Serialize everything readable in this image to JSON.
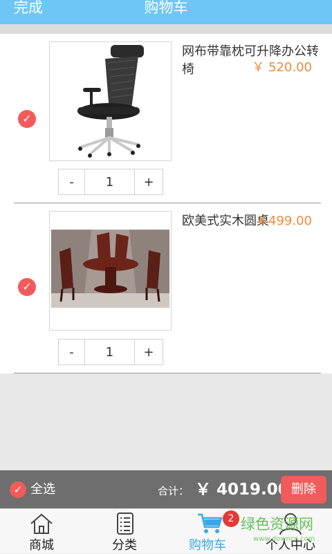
{
  "header": {
    "done_label": "完成",
    "title": "购物车"
  },
  "cart": {
    "items": [
      {
        "name": "网布带靠枕可升降办公转椅",
        "price": "￥ 520.00",
        "quantity": "1",
        "minus": "-",
        "plus": "+",
        "checked": true
      },
      {
        "name": "欧美式实木圆桌",
        "price": "￥499.00",
        "quantity": "1",
        "minus": "-",
        "plus": "+",
        "checked": true
      }
    ]
  },
  "summary": {
    "select_all": "全选",
    "total_label": "合计：",
    "total_value": "￥ 4019.00",
    "delete_label": "删除"
  },
  "tabbar": {
    "tabs": [
      {
        "label": "商城",
        "icon": "home-icon"
      },
      {
        "label": "分类",
        "icon": "list-icon"
      },
      {
        "label": "购物车",
        "icon": "cart-icon",
        "active": true
      },
      {
        "label": "个人中心",
        "icon": "user-icon"
      }
    ],
    "cart_badge": "2"
  },
  "watermark": {
    "text": "绿色资源网",
    "sub": "www.downcc.com"
  },
  "colors": {
    "header": "#6ec6f5",
    "accent": "#f25b5b",
    "price": "#f08a3c",
    "active_tab": "#3aa8e6"
  }
}
